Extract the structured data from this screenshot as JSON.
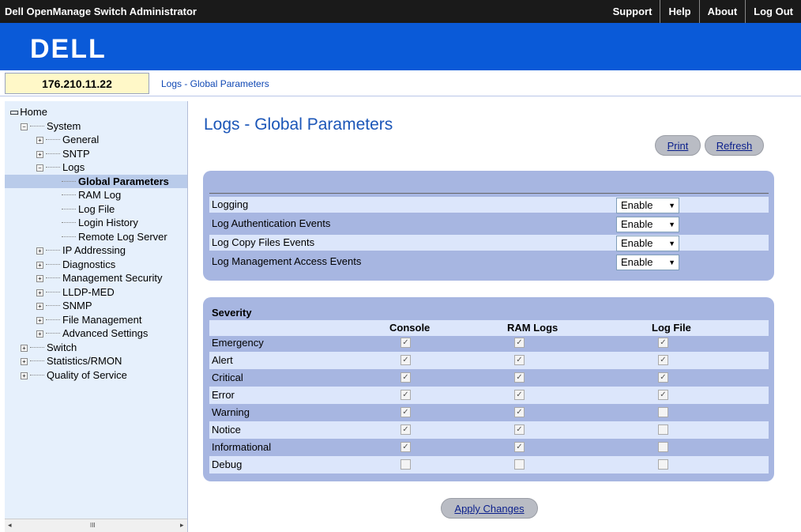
{
  "app_title": "Dell OpenManage Switch Administrator",
  "top_nav": [
    "Support",
    "Help",
    "About",
    "Log Out"
  ],
  "logo": "DELL",
  "ip_address": "176.210.11.22",
  "breadcrumb": "Logs - Global Parameters",
  "sidebar": {
    "items": [
      {
        "label": "Home",
        "depth": 0,
        "icon": "home-icon"
      },
      {
        "label": "System",
        "depth": 1,
        "expander": "-"
      },
      {
        "label": "General",
        "depth": 2,
        "expander": "+"
      },
      {
        "label": "SNTP",
        "depth": 2,
        "expander": "+"
      },
      {
        "label": "Logs",
        "depth": 2,
        "expander": "-"
      },
      {
        "label": "Global Parameters",
        "depth": 3,
        "selected": true
      },
      {
        "label": "RAM Log",
        "depth": 3
      },
      {
        "label": "Log File",
        "depth": 3
      },
      {
        "label": "Login History",
        "depth": 3
      },
      {
        "label": "Remote Log Server",
        "depth": 3
      },
      {
        "label": "IP Addressing",
        "depth": 2,
        "expander": "+"
      },
      {
        "label": "Diagnostics",
        "depth": 2,
        "expander": "+"
      },
      {
        "label": "Management Security",
        "depth": 2,
        "expander": "+"
      },
      {
        "label": "LLDP-MED",
        "depth": 2,
        "expander": "+"
      },
      {
        "label": "SNMP",
        "depth": 2,
        "expander": "+"
      },
      {
        "label": "File Management",
        "depth": 2,
        "expander": "+"
      },
      {
        "label": "Advanced Settings",
        "depth": 2,
        "expander": "+"
      },
      {
        "label": "Switch",
        "depth": 1,
        "expander": "+"
      },
      {
        "label": "Statistics/RMON",
        "depth": 1,
        "expander": "+"
      },
      {
        "label": "Quality of Service",
        "depth": 1,
        "expander": "+"
      }
    ],
    "scroll_thumb_label": "III"
  },
  "main": {
    "title": "Logs - Global Parameters",
    "print_label": "Print",
    "refresh_label": "Refresh",
    "apply_label": "Apply Changes"
  },
  "global_settings": [
    {
      "label": "Logging",
      "value": "Enable"
    },
    {
      "label": "Log Authentication Events",
      "value": "Enable"
    },
    {
      "label": "Log Copy Files Events",
      "value": "Enable"
    },
    {
      "label": "Log Management Access Events",
      "value": "Enable"
    }
  ],
  "severity": {
    "heading": "Severity",
    "columns": [
      "Console",
      "RAM Logs",
      "Log File"
    ],
    "rows": [
      {
        "label": "Emergency",
        "checks": [
          true,
          true,
          true
        ]
      },
      {
        "label": "Alert",
        "checks": [
          true,
          true,
          true
        ]
      },
      {
        "label": "Critical",
        "checks": [
          true,
          true,
          true
        ]
      },
      {
        "label": "Error",
        "checks": [
          true,
          true,
          true
        ]
      },
      {
        "label": "Warning",
        "checks": [
          true,
          true,
          false
        ]
      },
      {
        "label": "Notice",
        "checks": [
          true,
          true,
          false
        ]
      },
      {
        "label": "Informational",
        "checks": [
          true,
          true,
          false
        ]
      },
      {
        "label": "Debug",
        "checks": [
          false,
          false,
          false
        ]
      }
    ]
  }
}
